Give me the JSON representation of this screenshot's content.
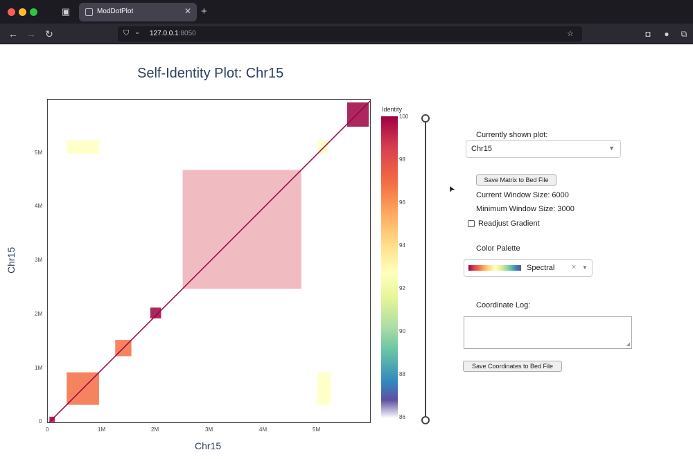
{
  "browser": {
    "tab_title": "ModDotPlot",
    "url_host": "127.0.0.1",
    "url_port": ":8050",
    "close_glyph": "✕",
    "new_tab_glyph": "+",
    "colors": {
      "close": "#ff5f57",
      "minimize": "#febc2e",
      "maximize": "#28c840"
    }
  },
  "plot": {
    "title": "Self-Identity Plot: Chr15",
    "x_title": "Chr15",
    "y_title": "Chr15",
    "colorbar_title": "Identity",
    "colorbar_ticks": [
      "100",
      "98",
      "96",
      "94",
      "92",
      "90",
      "88",
      "86"
    ],
    "x_ticks": [
      "0",
      "1M",
      "2M",
      "3M",
      "4M",
      "5M"
    ],
    "y_ticks": [
      "0",
      "1M",
      "2M",
      "3M",
      "4M",
      "5M"
    ]
  },
  "panel": {
    "shown_plot_label": "Currently shown plot:",
    "shown_plot_value": "Chr15",
    "save_matrix_button": "Save Matrix to Bed File",
    "current_window": "Current Window Size: 6000",
    "minimum_window": "Minimum Window Size: 3000",
    "readjust_gradient": "Readjust Gradient",
    "readjust_checked": false,
    "color_palette_label": "Color Palette",
    "palette_value": "Spectral",
    "coordinate_log_label": "Coordinate Log:",
    "coordinate_log_value": "",
    "save_coordinates_button": "Save Coordinates to Bed File"
  },
  "slider": {
    "range": [
      0,
      1
    ]
  },
  "chart_data": {
    "type": "heatmap",
    "title": "Self-Identity Plot: Chr15",
    "xlabel": "Chr15",
    "ylabel": "Chr15",
    "xlim": [
      0,
      6000000
    ],
    "ylim": [
      0,
      6000000
    ],
    "colorbar": {
      "label": "Identity",
      "range": [
        86,
        100
      ],
      "palette": "Spectral"
    },
    "blocks": [
      {
        "x": [
          5550000,
          5950000
        ],
        "y": [
          5500000,
          5950000
        ],
        "identity": 99.5
      },
      {
        "x": [
          2500000,
          4700000
        ],
        "y": [
          2500000,
          4700000
        ],
        "identity": 98.2
      },
      {
        "x": [
          1900000,
          2100000
        ],
        "y": [
          1950000,
          2150000
        ],
        "identity": 99.6
      },
      {
        "x": [
          1250000,
          1550000
        ],
        "y": [
          1250000,
          1550000
        ],
        "identity": 97.5
      },
      {
        "x": [
          350000,
          950000
        ],
        "y": [
          350000,
          950000
        ],
        "identity": 96.5
      },
      {
        "x": [
          30000,
          130000
        ],
        "y": [
          30000,
          130000
        ],
        "identity": 99.5
      },
      {
        "x": [
          350000,
          950000
        ],
        "y": [
          5000000,
          5250000
        ],
        "identity": 92.5
      },
      {
        "x": [
          5000000,
          5250000
        ],
        "y": [
          350000,
          950000
        ],
        "identity": 92.5
      },
      {
        "x": [
          5000000,
          5200000
        ],
        "y": [
          5000000,
          5250000
        ],
        "identity": 93.0
      }
    ],
    "diagonal": {
      "from": 0,
      "to": 6000000,
      "identity": 100
    }
  }
}
